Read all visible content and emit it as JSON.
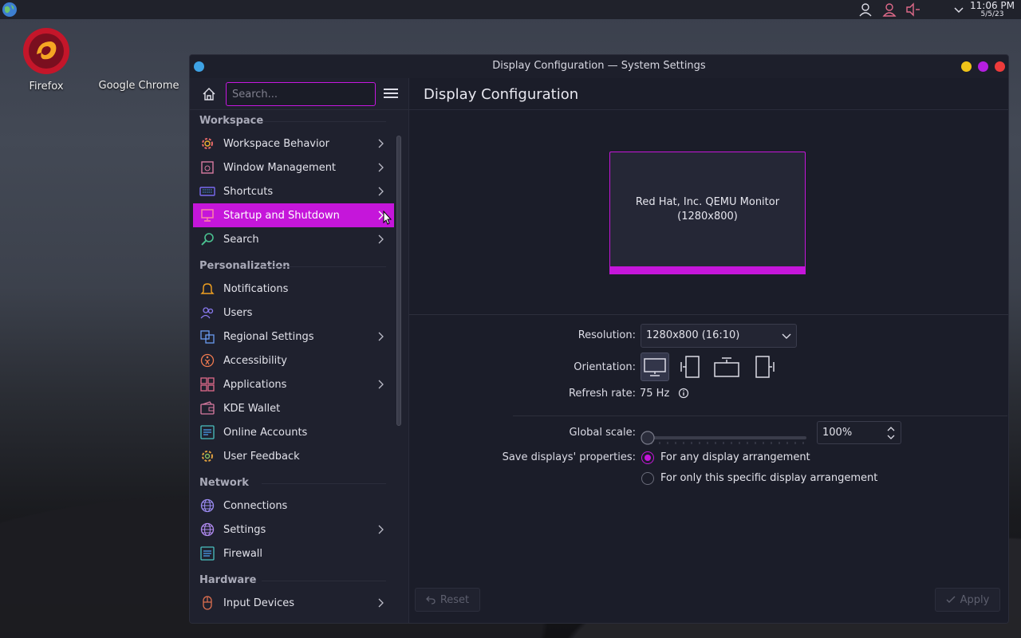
{
  "panel": {
    "clock_time": "11:06 PM",
    "clock_date": "5/5/23"
  },
  "desktop": {
    "icons": [
      {
        "label": "Firefox"
      },
      {
        "label": "Google Chrome"
      }
    ]
  },
  "window": {
    "title": "Display Configuration — System Settings"
  },
  "sidebar": {
    "search_placeholder": "Search...",
    "categories": {
      "workspace": "Workspace",
      "personalization": "Personalization",
      "network": "Network",
      "hardware": "Hardware"
    },
    "items": {
      "workspace_behavior": "Workspace Behavior",
      "window_management": "Window Management",
      "shortcuts": "Shortcuts",
      "startup_shutdown": "Startup and Shutdown",
      "search": "Search",
      "notifications": "Notifications",
      "users": "Users",
      "regional_settings": "Regional Settings",
      "accessibility": "Accessibility",
      "applications": "Applications",
      "kde_wallet": "KDE Wallet",
      "online_accounts": "Online Accounts",
      "user_feedback": "User Feedback",
      "connections": "Connections",
      "settings": "Settings",
      "firewall": "Firewall",
      "input_devices": "Input Devices"
    }
  },
  "main": {
    "title": "Display Configuration",
    "monitor_name": "Red Hat, Inc. QEMU Monitor",
    "monitor_res": "(1280x800)",
    "resolution_label": "Resolution:",
    "resolution_value": "1280x800 (16:10)",
    "orientation_label": "Orientation:",
    "refresh_label": "Refresh rate:",
    "refresh_value": "75 Hz",
    "scale_label": "Global scale:",
    "scale_value": "100%",
    "scale_fraction": 0,
    "save_label": "Save displays' properties:",
    "radio_any": "For any display arrangement",
    "radio_specific": "For only this specific display arrangement",
    "reset_label": "Reset",
    "apply_label": "Apply"
  },
  "colors": {
    "accent": "#c516da",
    "window_bg": "#1b1d29",
    "sidebar_bg": "#1f212e"
  }
}
